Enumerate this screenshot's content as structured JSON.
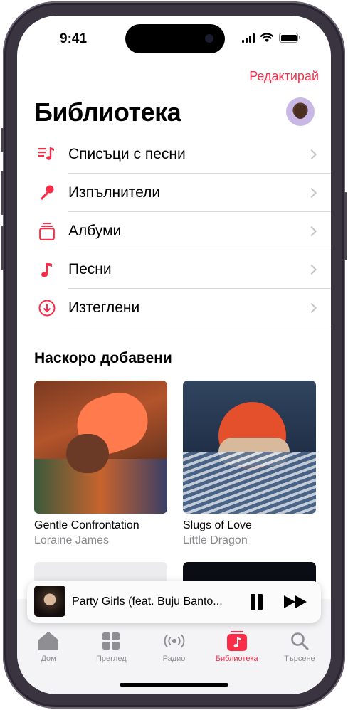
{
  "status": {
    "time": "9:41"
  },
  "header": {
    "edit_label": "Редактирай",
    "title": "Библиотека"
  },
  "menu": [
    {
      "label": "Списъци с песни",
      "icon": "playlist-icon"
    },
    {
      "label": "Изпълнители",
      "icon": "microphone-icon"
    },
    {
      "label": "Албуми",
      "icon": "album-stack-icon"
    },
    {
      "label": "Песни",
      "icon": "music-note-icon"
    },
    {
      "label": "Изтеглени",
      "icon": "download-circle-icon"
    }
  ],
  "recent": {
    "title": "Наскоро добавени",
    "albums": [
      {
        "name": "Gentle Confrontation",
        "artist": "Loraine James"
      },
      {
        "name": "Slugs of Love",
        "artist": "Little Dragon"
      }
    ]
  },
  "now_playing": {
    "title": "Party Girls (feat. Buju Banto..."
  },
  "tabs": [
    {
      "label": "Дом",
      "icon": "home-icon",
      "active": false
    },
    {
      "label": "Преглед",
      "icon": "grid-icon",
      "active": false
    },
    {
      "label": "Радио",
      "icon": "radio-icon",
      "active": false
    },
    {
      "label": "Библиотека",
      "icon": "library-music-icon",
      "active": true
    },
    {
      "label": "Търсене",
      "icon": "search-icon",
      "active": false
    }
  ],
  "colors": {
    "accent": "#fa2d48",
    "secondary_text": "#8a8a8e",
    "separator": "#d9d9dc"
  }
}
